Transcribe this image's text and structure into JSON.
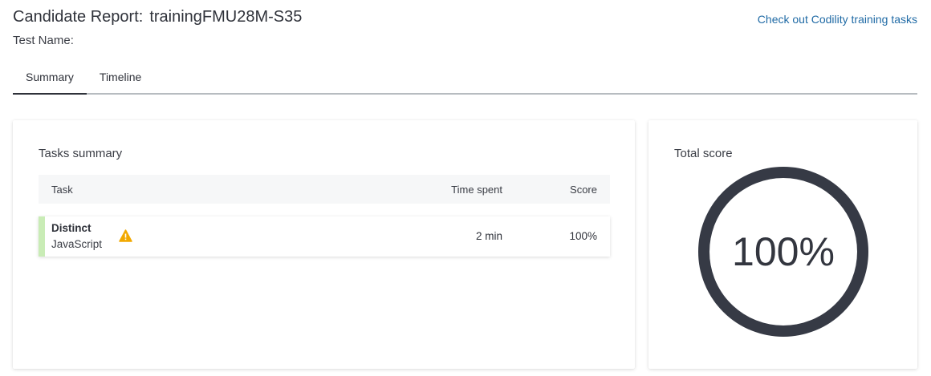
{
  "header": {
    "title": "Candidate Report:",
    "candidate_id": "trainingFMU28M-S35",
    "test_name_label": "Test Name:",
    "training_link": "Check out Codility training tasks"
  },
  "tabs": [
    {
      "label": "Summary",
      "active": true
    },
    {
      "label": "Timeline",
      "active": false
    }
  ],
  "tasks_summary": {
    "heading": "Tasks summary",
    "columns": {
      "task": "Task",
      "time": "Time spent",
      "score": "Score"
    },
    "rows": [
      {
        "name": "Distinct",
        "language": "JavaScript",
        "warning_icon": "warning-triangle-icon",
        "time": "2 min",
        "score": "100%",
        "status_color": "#c9ecb6"
      }
    ]
  },
  "total_score": {
    "heading": "Total score",
    "value": "100%",
    "fraction": 1.0,
    "ring_color": "#363a45"
  }
}
